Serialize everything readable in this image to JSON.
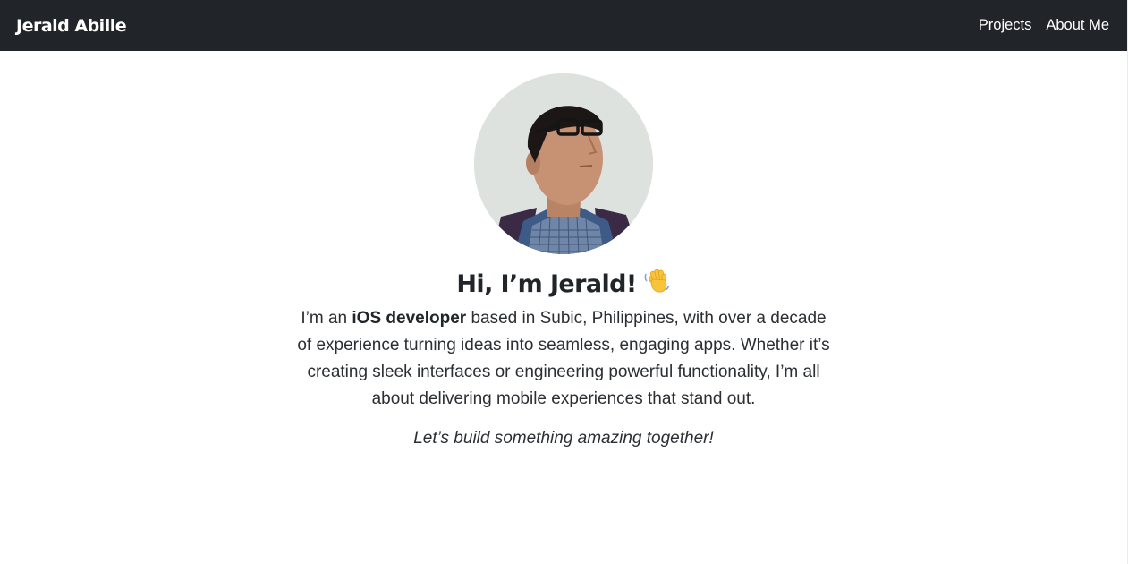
{
  "navbar": {
    "brand": "Jerald Abille",
    "links": [
      {
        "label": "Projects"
      },
      {
        "label": "About Me"
      }
    ]
  },
  "hero": {
    "headline": "Hi, I’m Jerald!",
    "headline_icon": "waving-hand-icon",
    "bio": {
      "intro": "I’m an",
      "highlight": "iOS developer",
      "rest": "based in Subic, Philippines, with over a decade of experience turning ideas into seamless, engaging apps. Whether it’s creating sleek interfaces or engineering powerful functionality, I’m all about delivering mobile experiences that stand out."
    },
    "tagline": "Let’s build something amazing together!"
  },
  "colors": {
    "navbar_bg": "#212529",
    "navbar_text": "#ffffff",
    "body_text": "#212529",
    "page_bg": "#ffffff"
  }
}
